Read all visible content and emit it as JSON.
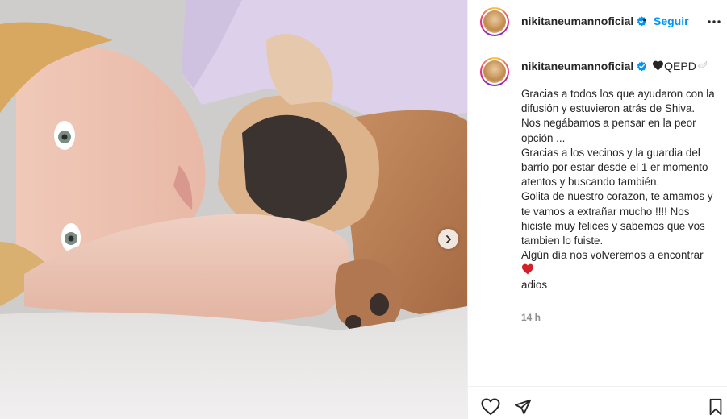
{
  "post": {
    "username": "nikitaneumannoficial",
    "follow_label": "Seguir",
    "dot": "•",
    "caption_suffix": "QEPD",
    "caption_emojis": [
      "black-heart-icon",
      "dove-icon"
    ],
    "caption_lines": "Gracias a todos los que ayudaron con la difusión y estuvieron atrás de Shiva.\nNos negábamos a pensar en la peor opción ...\nGracias a los vecinos y la guardia del barrio por estar desde el 1 er momento atentos y buscando también.\nGolita de nuestro corazon, te amamos y te vamos a extrañar mucho !!!! Nos hiciste muy felices y sabemos que vos tambien lo fuiste.\nAlgún día nos volveremos a encontrar",
    "caption_end": "adios",
    "timestamp": "14 h"
  },
  "icons": {
    "verified": "verified-badge-icon",
    "more": "more-options-icon",
    "next": "chevron-right-icon",
    "like": "heart-outline-icon",
    "share": "paper-plane-icon",
    "save": "bookmark-icon",
    "red_heart": "red-heart-icon"
  },
  "colors": {
    "accent": "#0095f6",
    "text": "#262626",
    "muted": "#8e8e8e",
    "verified": "#0095f6"
  }
}
